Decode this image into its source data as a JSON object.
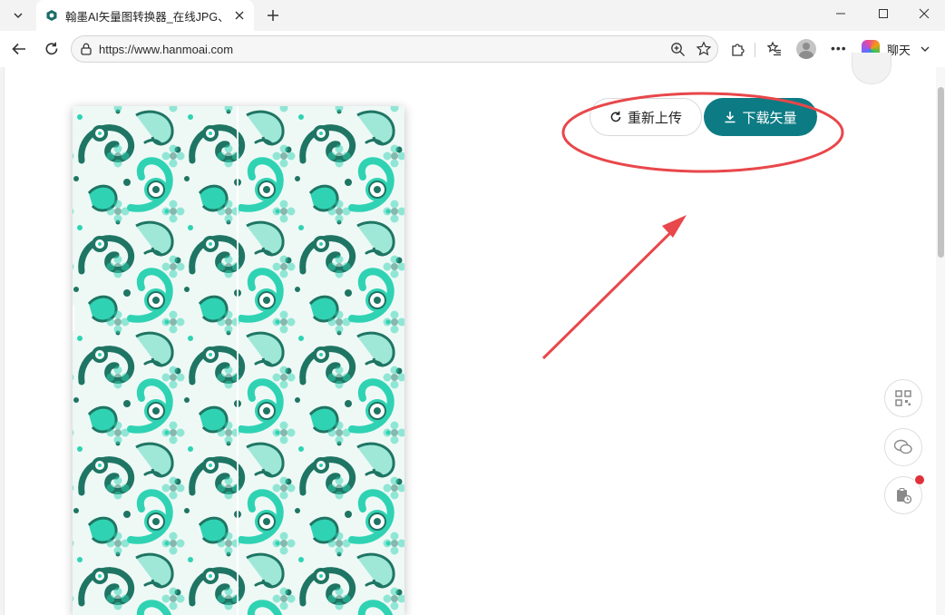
{
  "browser": {
    "tab_title": "翰墨AI矢量图转换器_在线JPG、PNG",
    "url": "https://www.hanmoai.com",
    "copilot_label": "聊天"
  },
  "page": {
    "reupload_label": "重新上传",
    "download_label": "下载矢量"
  },
  "colors": {
    "accent": "#0d7b84",
    "annotation": "#e8474b",
    "pattern_light": "#2fd3b3",
    "pattern_dark": "#1f7563"
  },
  "icons": {
    "reupload": "refresh-icon",
    "download": "download-icon",
    "float_1": "qrcode-icon",
    "float_2": "wechat-icon",
    "float_3": "clipboard-clock-icon"
  }
}
